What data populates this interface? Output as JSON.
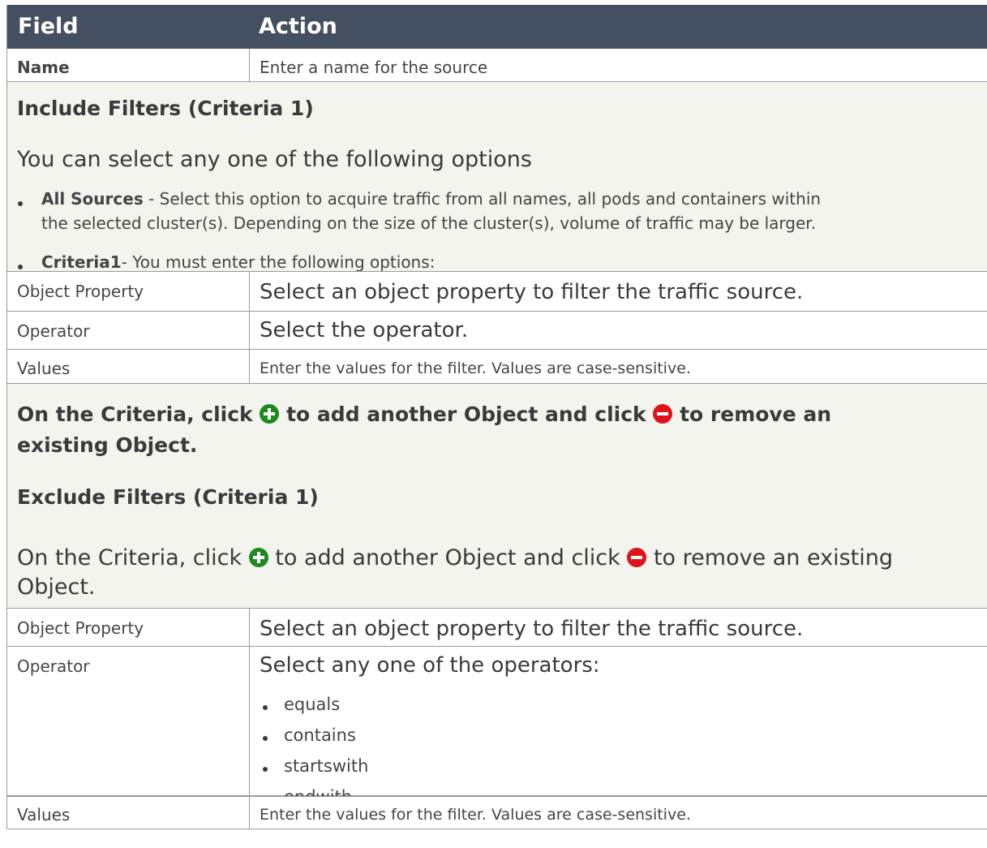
{
  "header": {
    "field": "Field",
    "action": "Action"
  },
  "name_row": {
    "label": "Name",
    "text": "Enter a name for the source"
  },
  "include": {
    "title": "Include Filters (Criteria 1)",
    "intro": "You can select any one of the following options",
    "all_sources_label": "All Sources",
    "all_sources_text_1": " - Select this option to acquire traffic from all names, all pods and containers within",
    "all_sources_text_2": "the selected cluster(s). Depending on the size of the cluster(s), volume of traffic may be larger.",
    "criteria_label": "Criteria1",
    "criteria_text": "- You must enter the following options:",
    "rows": [
      {
        "label": "Object Property",
        "text": "Select an object property to filter the traffic source."
      },
      {
        "label": "Operator",
        "text": "Select the operator."
      },
      {
        "label": "Values",
        "text": "Enter the values for the filter. Values are case-sensitive."
      }
    ],
    "note_part1": "On the Criteria, click ",
    "note_part2": " to add another Object and click ",
    "note_part3": " to remove an",
    "note_part4": "existing Object."
  },
  "exclude": {
    "title": "Exclude Filters (Criteria 1)",
    "note_part1": "On the Criteria, click ",
    "note_part2": " to add another Object and click ",
    "note_part3": " to remove an existing",
    "note_part4": "Object.",
    "rows": [
      {
        "label": "Object Property",
        "text": "Select an object property to filter the traffic source."
      },
      {
        "label": "Operator",
        "text": "Select any one of the operators:"
      },
      {
        "label": "Values",
        "text": "Enter the values for the filter. Values are case-sensitive."
      }
    ],
    "operators": [
      "equals",
      "contains",
      "startswith",
      "endwith"
    ]
  },
  "icons": {
    "add": "plus-circle-icon",
    "remove": "minus-circle-icon",
    "add_color": "#1e8a1e",
    "remove_color": "#e0121b"
  }
}
